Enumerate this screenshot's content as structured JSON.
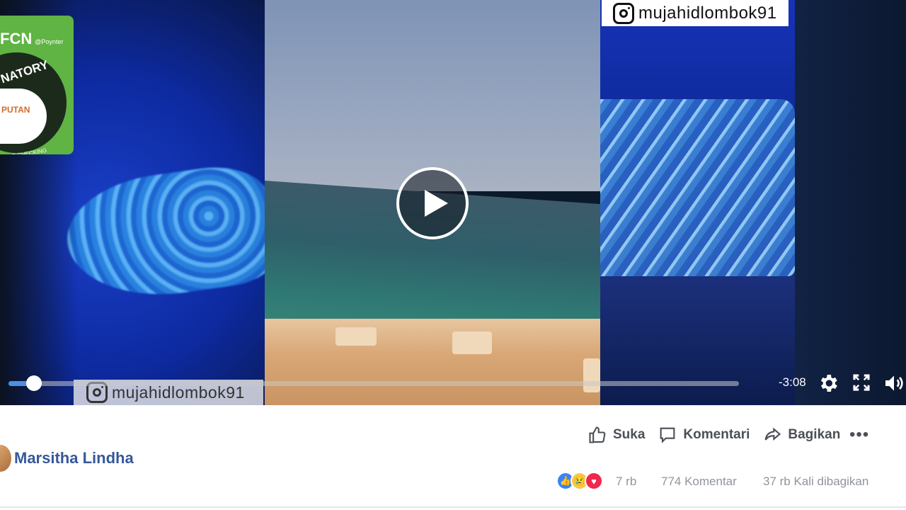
{
  "video": {
    "watermark_top": "mujahidlombok91",
    "watermark_bottom": "mujahidlombok91",
    "time_remaining": "-3:08",
    "progress": 0.035
  },
  "badge": {
    "top": "FCN",
    "top_sub": "@Poynter",
    "ring": "NATORY",
    "logo": "PUTAN",
    "network": "FACT-CHECKING NETWORK"
  },
  "post": {
    "author": "Marsitha Lindha",
    "actions": {
      "like": "Suka",
      "comment": "Komentari",
      "share": "Bagikan"
    },
    "more": "•••",
    "reaction_count": "7 rb",
    "comments_count": "774 Komentar",
    "shares_count": "37 rb Kali dibagikan"
  },
  "icons": {
    "like": "thumbs-up-icon",
    "comment": "comment-icon",
    "share": "share-icon",
    "settings": "gear-icon",
    "fullscreen": "fullscreen-icon",
    "volume": "volume-icon",
    "play": "play-icon",
    "instagram": "instagram-icon"
  },
  "colors": {
    "author": "#365899",
    "progress": "#4a90e2",
    "badge": "#5fb444"
  }
}
